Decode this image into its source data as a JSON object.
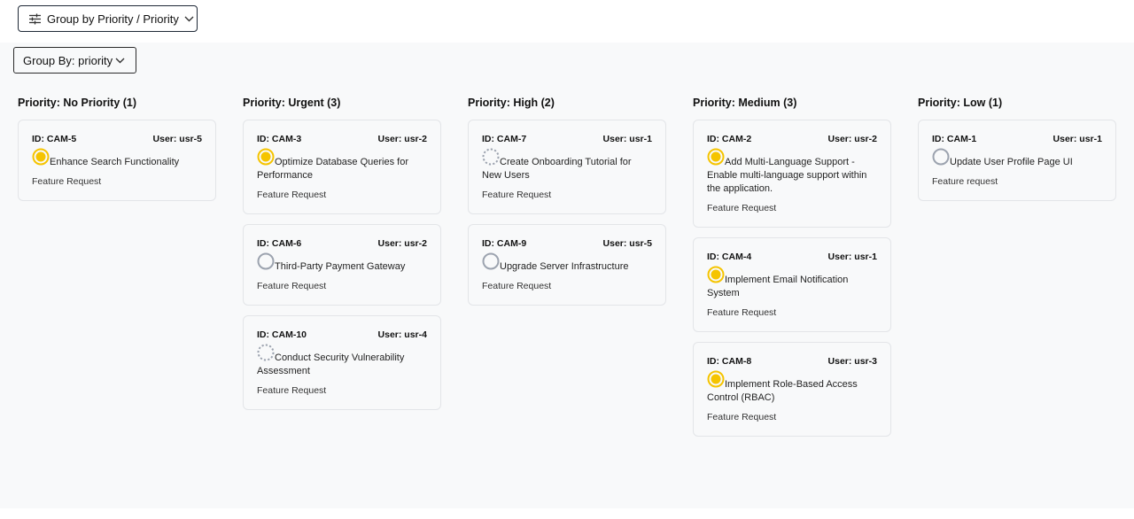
{
  "toolbar": {
    "display_label": "Group by Priority / Priority",
    "group_by_label": "Group By: priority"
  },
  "colors": {
    "in_progress": "#f5c400",
    "todo_ring": "#9ca3af"
  },
  "columns": [
    {
      "title": "Priority: No Priority (1)",
      "cards": [
        {
          "id": "ID: CAM-5",
          "user": "User: usr-5",
          "status": "in-progress",
          "title": "Enhance Search Functionality",
          "tag": "Feature Request"
        }
      ]
    },
    {
      "title": "Priority: Urgent (3)",
      "cards": [
        {
          "id": "ID: CAM-3",
          "user": "User: usr-2",
          "status": "in-progress",
          "title": "Optimize Database Queries for Performance",
          "tag": "Feature Request"
        },
        {
          "id": "ID: CAM-6",
          "user": "User: usr-2",
          "status": "todo",
          "title": "Third-Party Payment Gateway",
          "tag": "Feature Request"
        },
        {
          "id": "ID: CAM-10",
          "user": "User: usr-4",
          "status": "backlog",
          "title": "Conduct Security Vulnerability Assessment",
          "tag": "Feature Request"
        }
      ]
    },
    {
      "title": "Priority: High (2)",
      "cards": [
        {
          "id": "ID: CAM-7",
          "user": "User: usr-1",
          "status": "backlog",
          "title": "Create Onboarding Tutorial for New Users",
          "tag": "Feature Request"
        },
        {
          "id": "ID: CAM-9",
          "user": "User: usr-5",
          "status": "todo",
          "title": "Upgrade Server Infrastructure",
          "tag": "Feature Request"
        }
      ]
    },
    {
      "title": "Priority: Medium (3)",
      "cards": [
        {
          "id": "ID: CAM-2",
          "user": "User: usr-2",
          "status": "in-progress",
          "title": "Add Multi-Language Support - Enable multi-language support within the application.",
          "tag": "Feature Request"
        },
        {
          "id": "ID: CAM-4",
          "user": "User: usr-1",
          "status": "in-progress",
          "title": "Implement Email Notification System",
          "tag": "Feature Request"
        },
        {
          "id": "ID: CAM-8",
          "user": "User: usr-3",
          "status": "in-progress",
          "title": "Implement Role-Based Access Control (RBAC)",
          "tag": "Feature Request"
        }
      ]
    },
    {
      "title": "Priority: Low (1)",
      "cards": [
        {
          "id": "ID: CAM-1",
          "user": "User: usr-1",
          "status": "todo",
          "title": "Update User Profile Page UI",
          "tag": "Feature request"
        }
      ]
    }
  ]
}
